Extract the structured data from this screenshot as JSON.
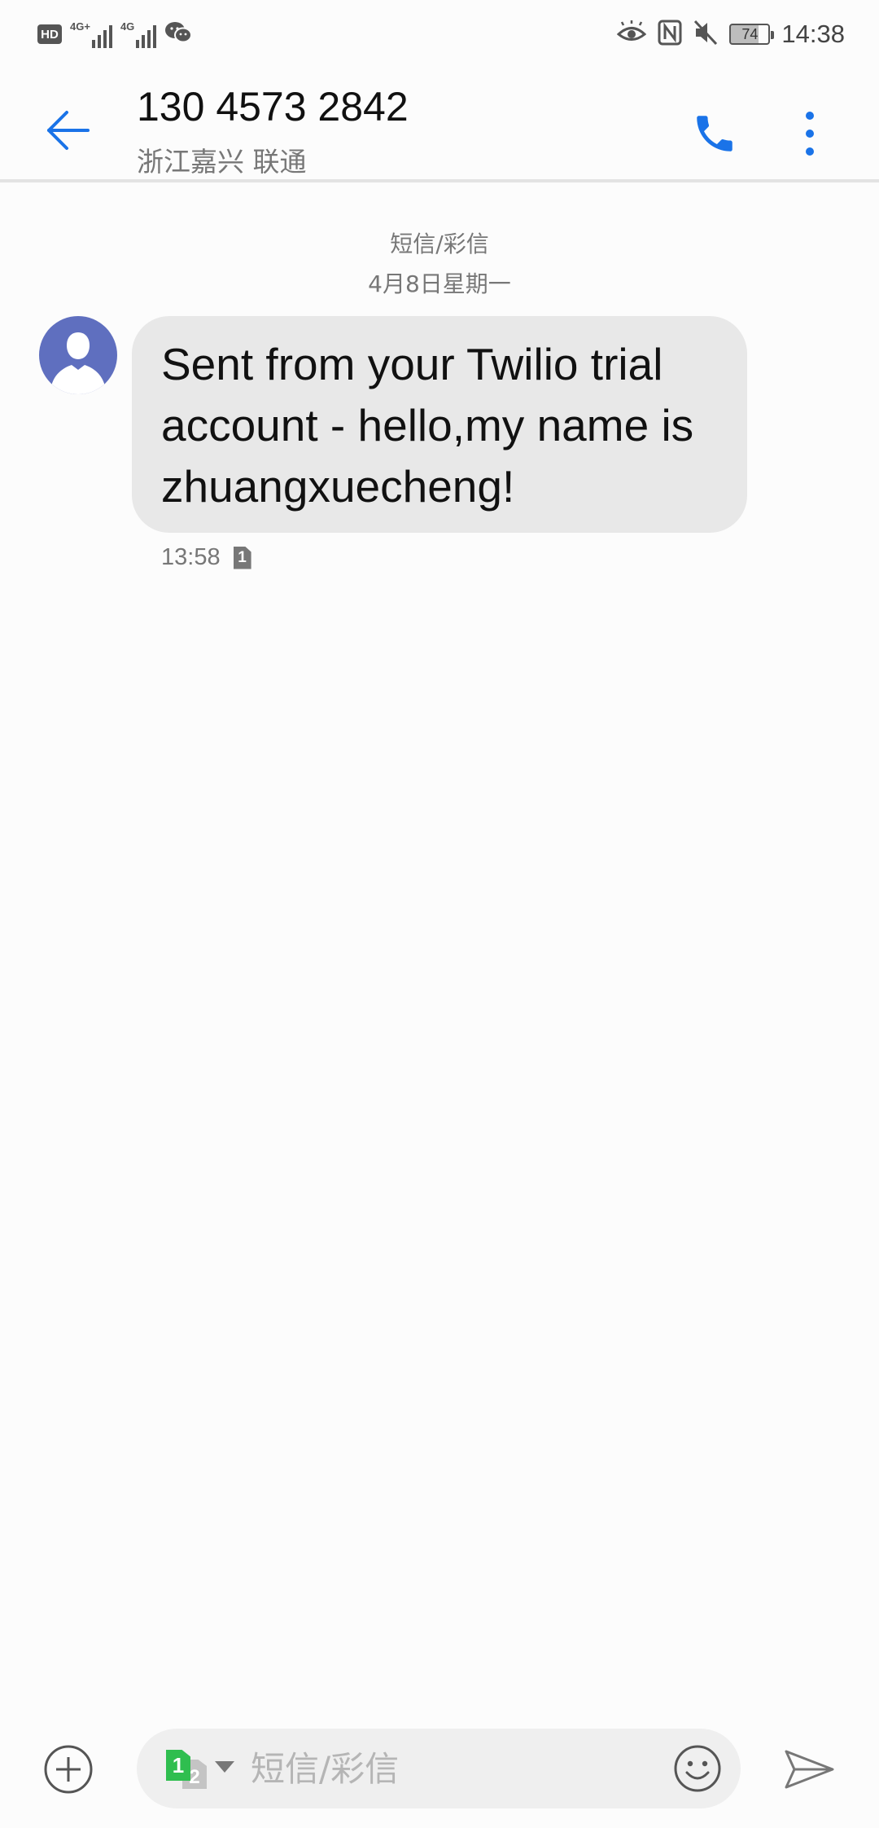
{
  "status_bar": {
    "hd_label": "HD",
    "sim1_network": "4G+",
    "sim2_network": "4G",
    "battery_level": "74",
    "time": "14:38",
    "icons": [
      "hd-icon",
      "signal-icon",
      "wechat-icon",
      "eye-icon",
      "nfc-icon",
      "mute-icon",
      "battery-icon"
    ]
  },
  "header": {
    "contact_number": "130 4573 2842",
    "contact_location": "浙江嘉兴 联通",
    "icons": [
      "back-arrow-icon",
      "phone-icon",
      "more-vert-icon"
    ]
  },
  "conversation": {
    "type_label": "短信/彩信",
    "date_label": "4月8日星期一",
    "messages": [
      {
        "text": "Sent from your Twilio trial account - hello,my name is  zhuangxuecheng!",
        "time": "13:58",
        "sim": "1"
      }
    ]
  },
  "composer": {
    "sim_primary": "1",
    "sim_secondary": "2",
    "placeholder": "短信/彩信",
    "value": "",
    "icons": [
      "add-icon",
      "emoji-icon",
      "send-icon"
    ]
  },
  "colors": {
    "accent": "#1a73e8",
    "avatar_bg": "#5f6fbf",
    "bubble_bg": "#e8e8e8",
    "sim_green": "#2fbe4f"
  }
}
